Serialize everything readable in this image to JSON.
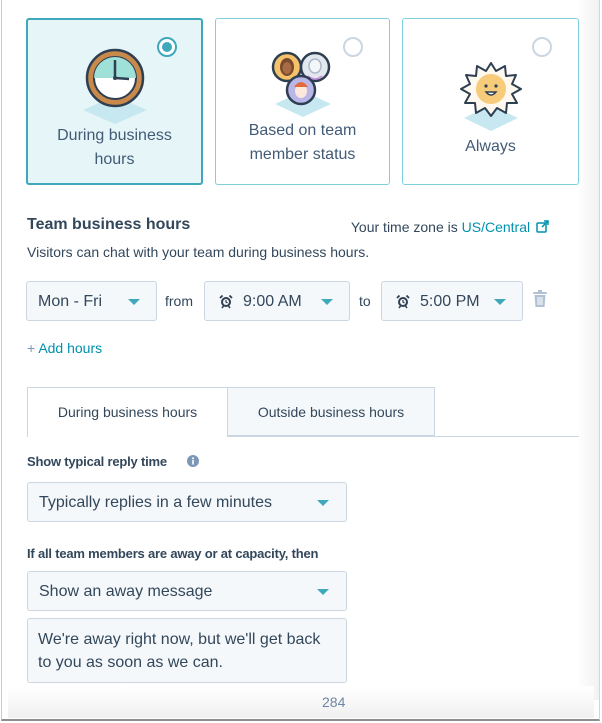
{
  "availability_options": [
    {
      "label": "During business hours",
      "selected": true,
      "icon": "clock-icon"
    },
    {
      "label": "Based on team member status",
      "selected": false,
      "icon": "team-avatars-icon"
    },
    {
      "label": "Always",
      "selected": false,
      "icon": "sun-icon"
    }
  ],
  "business_hours": {
    "title": "Team business hours",
    "timezone_prefix": "Your time zone is",
    "timezone_link": "US/Central",
    "timezone_icon": "external-link-icon",
    "description": "Visitors can chat with your team during business hours.",
    "days": "Mon - Fri",
    "from_label": "from",
    "start_time": "9:00 AM",
    "to_label": "to",
    "end_time": "5:00 PM",
    "delete_icon": "trash-icon",
    "add_hours_plus": "+",
    "add_hours_label": "Add hours"
  },
  "tabs": [
    {
      "label": "During business hours",
      "active": true
    },
    {
      "label": "Outside business hours",
      "active": false
    }
  ],
  "reply_time": {
    "label": "Show typical reply time",
    "info_icon": "info-icon",
    "value": "Typically replies in a few minutes"
  },
  "away": {
    "label": "If all team members are away or at capacity, then",
    "value": "Show an away message",
    "message": "We're away right now, but we'll get back to you as soon as we can."
  },
  "page_number": "284",
  "colors": {
    "accent": "#3fa8bb",
    "link": "#0091ae",
    "text": "#33475b",
    "selected_card_bg": "#e5f5f8",
    "input_bg": "#f5f8fa",
    "border": "#cbd6e2"
  }
}
